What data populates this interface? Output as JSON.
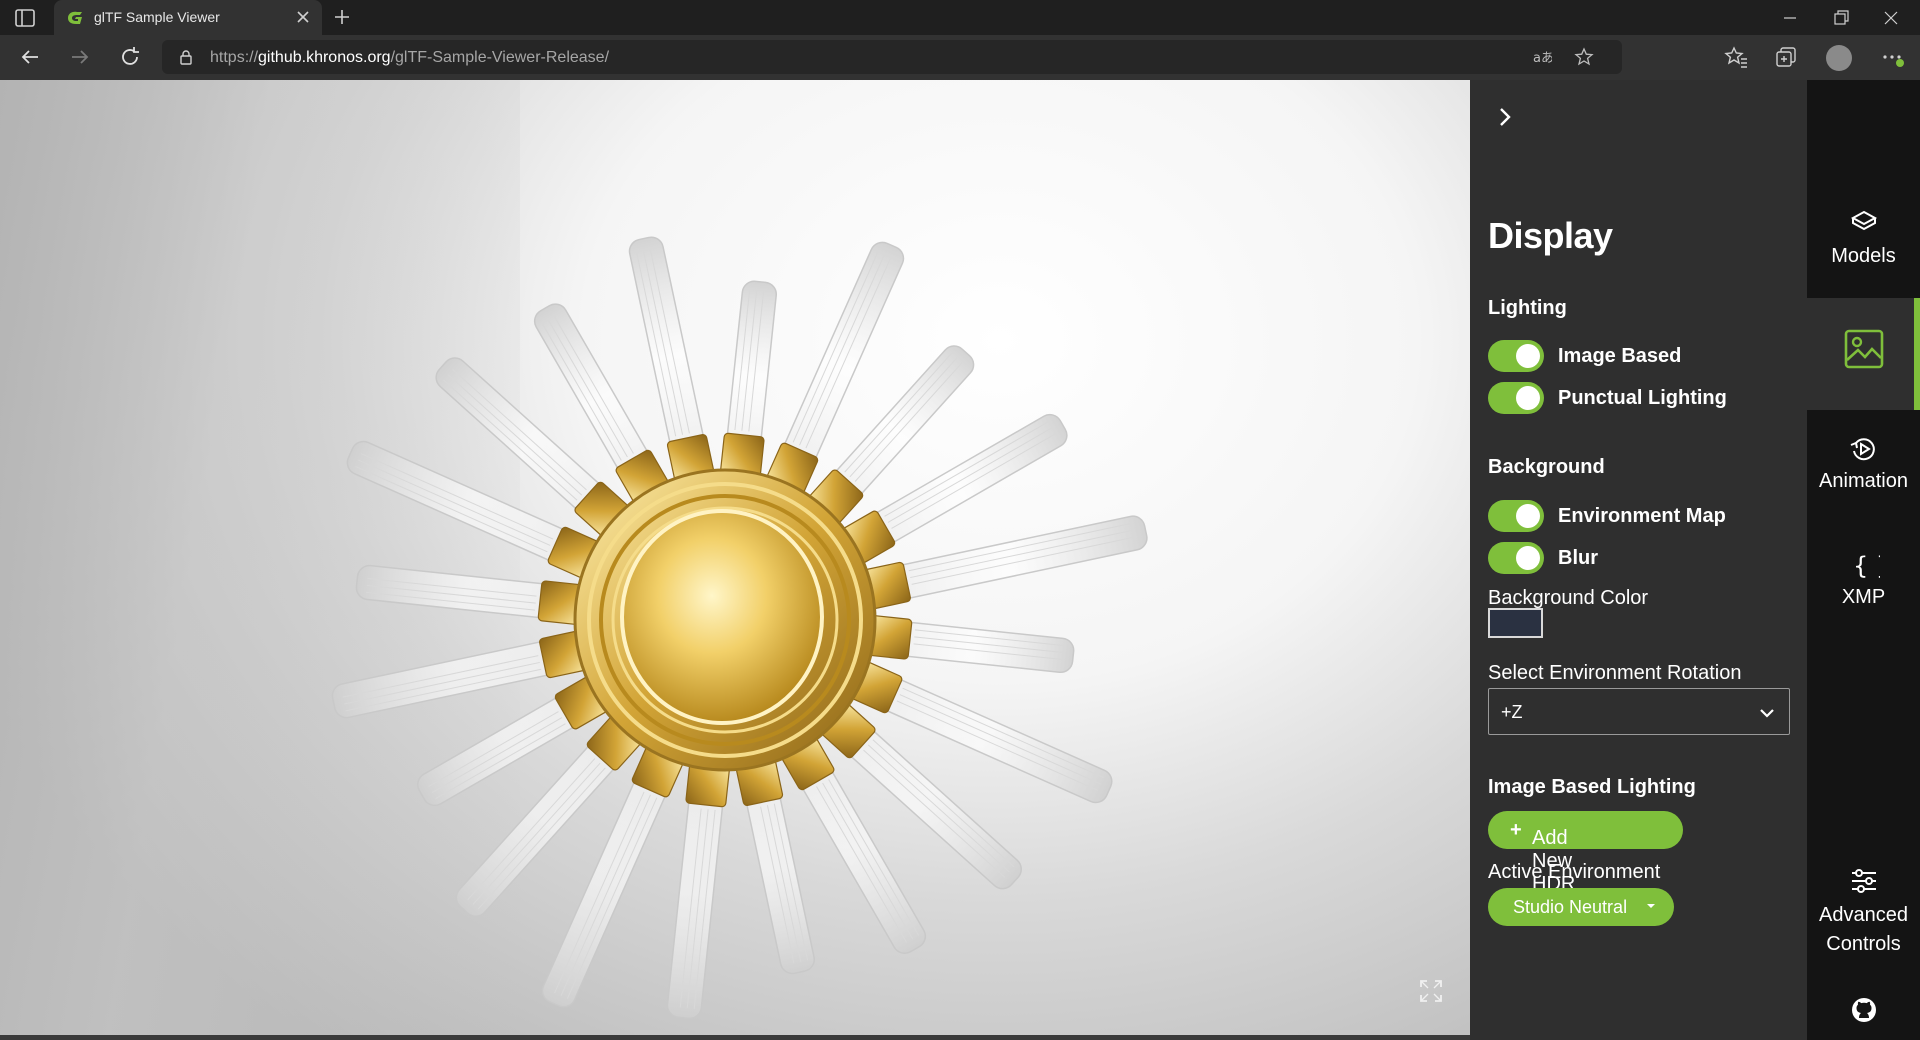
{
  "browser": {
    "tab_title": "glTF Sample Viewer",
    "url_host": "github.khronos.org",
    "url_prefix": "https://",
    "url_path": "/glTF-Sample-Viewer-Release/"
  },
  "panel": {
    "title": "Display",
    "lighting": {
      "heading": "Lighting",
      "toggles": [
        {
          "label": "Image Based",
          "on": true
        },
        {
          "label": "Punctual Lighting",
          "on": true
        }
      ]
    },
    "background": {
      "heading": "Background",
      "toggles": [
        {
          "label": "Environment Map",
          "on": true
        },
        {
          "label": "Blur",
          "on": true
        }
      ],
      "color_label": "Background Color",
      "color_value": "#2a3141"
    },
    "rotation": {
      "label": "Select Environment Rotation",
      "value": "+Z"
    },
    "ibl": {
      "heading": "Image Based Lighting",
      "add_button": "Add New HDR",
      "active_label": "Active Environment",
      "active_value": "Studio Neutral"
    }
  },
  "rail": {
    "items": [
      {
        "label": "Models",
        "icon": "cube-icon"
      },
      {
        "label": "",
        "icon": "image-icon",
        "active": true
      },
      {
        "label": "Animation",
        "icon": "play-circle-icon"
      },
      {
        "label": "XMP",
        "icon": "braces-icon"
      },
      {
        "label": "Advanced\nControls",
        "icon": "sliders-icon"
      },
      {
        "label": "",
        "icon": "github-icon"
      }
    ]
  },
  "colors": {
    "accent": "#7fbf3b",
    "panel_bg": "#2f2f2f",
    "rail_bg": "#141414"
  }
}
